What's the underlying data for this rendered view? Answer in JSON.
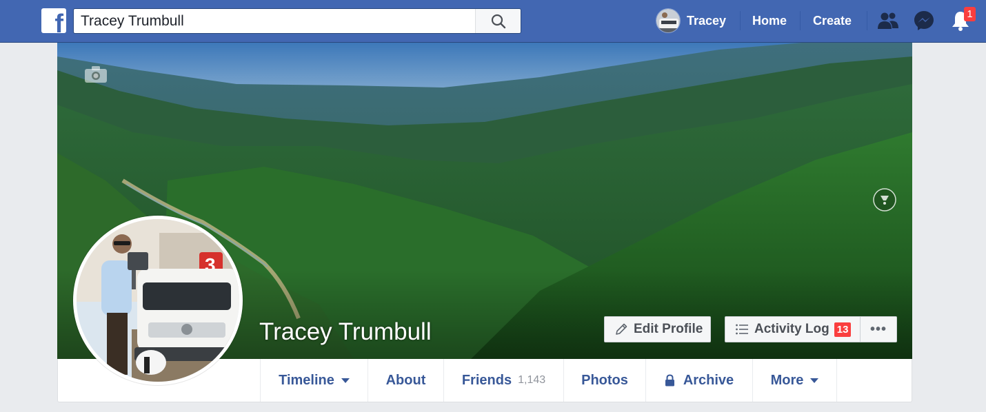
{
  "search": {
    "value": "Tracey Trumbull"
  },
  "nav": {
    "user_name": "Tracey",
    "home": "Home",
    "create": "Create",
    "notification_count": "1",
    "icons": [
      "facebook-logo-icon",
      "search-icon",
      "friend-requests-icon",
      "messenger-icon",
      "notifications-bell-icon"
    ]
  },
  "cover": {
    "icons": [
      "camera-icon",
      "panorama-360-icon"
    ]
  },
  "profile": {
    "name": "Tracey Trumbull"
  },
  "actions": {
    "edit_profile": "Edit Profile",
    "activity_log": "Activity Log",
    "activity_count": "13",
    "more": "•••"
  },
  "tabs": [
    {
      "label": "Timeline",
      "dropdown": true
    },
    {
      "label": "About"
    },
    {
      "label": "Friends",
      "count": "1,143"
    },
    {
      "label": "Photos"
    },
    {
      "label": "Archive",
      "icon": "lock-icon"
    },
    {
      "label": "More",
      "dropdown": true
    }
  ],
  "colors": {
    "brand_blue": "#4267b2",
    "link_blue": "#385898",
    "badge_red": "#fa3e3e",
    "page_bg": "#e9ebee"
  }
}
